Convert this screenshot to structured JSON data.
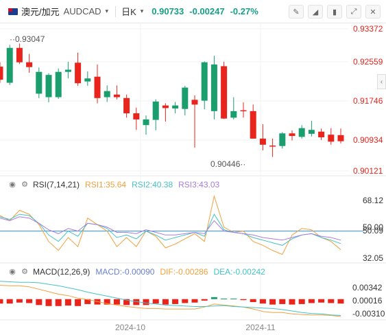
{
  "header": {
    "pair_name": "澳元/加元",
    "symbol": "AUDCAD",
    "caret": "▾",
    "period": "日K",
    "period_caret": "▾",
    "price": "0.90733",
    "change": "-0.00247",
    "change_pct": "-0.27%",
    "tools": [
      "pencil-ruler-icon",
      "brush-icon",
      "candlestick-icon",
      "expand-icon",
      "close-icon"
    ]
  },
  "colors": {
    "up": "#e8241c",
    "down": "#1a9e6e",
    "rsi1": "#f2a03c",
    "rsi2": "#45c2c7",
    "rsi3": "#a77be0",
    "dif": "#f2a03c",
    "dea": "#45c2c7",
    "ref": "#2f8bd6",
    "axis_text": "#e8241c"
  },
  "chart_data": [
    {
      "type": "candlestick",
      "x_ticks": [
        "2024-10",
        "2024-11"
      ],
      "y_ticks": [
        "0.93372",
        "0.92559",
        "0.91746",
        "0.90934",
        "0.90121"
      ],
      "ylim": [
        0.9005,
        0.9345
      ],
      "annotations": {
        "high": "0.93047",
        "low": "0.90446"
      },
      "ohlc": [
        [
          0.9252,
          0.9262,
          0.9215,
          0.9222
        ],
        [
          0.9215,
          0.9302,
          0.921,
          0.9295
        ],
        [
          0.9295,
          0.9305,
          0.9258,
          0.9262
        ],
        [
          0.9262,
          0.9281,
          0.9238,
          0.9251
        ],
        [
          0.919,
          0.925,
          0.918,
          0.924
        ],
        [
          0.9182,
          0.9237,
          0.917,
          0.9233
        ],
        [
          0.9182,
          0.9248,
          0.9178,
          0.924
        ],
        [
          0.924,
          0.9263,
          0.9225,
          0.9245
        ],
        [
          0.9261,
          0.9284,
          0.9208,
          0.9214
        ],
        [
          0.9218,
          0.9241,
          0.9208,
          0.9225
        ],
        [
          0.9229,
          0.9257,
          0.9168,
          0.918
        ],
        [
          0.9182,
          0.9209,
          0.9171,
          0.9196
        ],
        [
          0.9188,
          0.9209,
          0.9177,
          0.9182
        ],
        [
          0.918,
          0.9188,
          0.9135,
          0.9145
        ],
        [
          0.9145,
          0.9158,
          0.9107,
          0.9131
        ],
        [
          0.9118,
          0.914,
          0.9096,
          0.9131
        ],
        [
          0.913,
          0.9177,
          0.9106,
          0.9172
        ],
        [
          0.9163,
          0.9168,
          0.9126,
          0.9157
        ],
        [
          0.9156,
          0.9171,
          0.9145,
          0.9163
        ],
        [
          0.9155,
          0.9208,
          0.914,
          0.9204
        ],
        [
          0.9176,
          0.9186,
          0.9066,
          0.9165
        ],
        [
          0.9174,
          0.9264,
          0.9154,
          0.9262
        ],
        [
          0.915,
          0.9277,
          0.9131,
          0.9257
        ],
        [
          0.9253,
          0.9263,
          0.9132,
          0.9133
        ],
        [
          0.9135,
          0.9182,
          0.9131,
          0.915
        ],
        [
          0.9152,
          0.917,
          0.9135,
          0.915
        ],
        [
          0.915,
          0.9165,
          0.9087,
          0.9087
        ],
        [
          0.9087,
          0.912,
          0.906,
          0.9073
        ],
        [
          0.9071,
          0.9087,
          0.9045,
          0.907
        ],
        [
          0.907,
          0.9102,
          0.9064,
          0.9099
        ],
        [
          0.9099,
          0.9106,
          0.9083,
          0.9093
        ],
        [
          0.9091,
          0.9118,
          0.9087,
          0.9111
        ],
        [
          0.9098,
          0.9128,
          0.9092,
          0.9107
        ],
        [
          0.9103,
          0.911,
          0.9084,
          0.909
        ],
        [
          0.9096,
          0.9111,
          0.9073,
          0.908
        ],
        [
          0.9095,
          0.911,
          0.9076,
          0.9081
        ]
      ]
    },
    {
      "type": "line",
      "label": "RSI(7,14,21)",
      "y_ticks": [
        "68.12",
        "50.00",
        "50.09",
        "32.05"
      ],
      "ylim": [
        27,
        80
      ],
      "ref_level": 50,
      "series": [
        {
          "name": "RSI1",
          "value_label": "RSI1:35.64",
          "values": [
            62,
            58,
            66,
            63,
            55,
            42,
            35,
            45,
            38,
            60,
            55,
            50,
            38,
            45,
            38,
            50,
            46,
            37,
            40,
            44,
            48,
            42,
            77,
            53,
            49,
            50,
            42,
            39,
            35,
            32,
            47,
            52,
            51,
            45,
            42,
            35.64
          ]
        },
        {
          "name": "RSI2",
          "value_label": "RSI2:40.38",
          "values": [
            61,
            59,
            63,
            62,
            56,
            47,
            42,
            50,
            46,
            56,
            55,
            52,
            45,
            47,
            44,
            50,
            47,
            43,
            45,
            47,
            49,
            46,
            63,
            51,
            49,
            48,
            45,
            43,
            41,
            39,
            44,
            47,
            48,
            45,
            43,
            40.38
          ]
        },
        {
          "name": "RSI3",
          "value_label": "RSI3:43.03",
          "values": [
            60,
            58,
            61,
            60,
            56,
            51,
            48,
            52,
            50,
            56,
            55,
            53,
            49,
            49,
            48,
            51,
            49,
            47,
            47,
            48,
            49,
            48,
            58,
            50,
            49,
            48,
            47,
            45,
            44,
            43,
            45,
            47,
            48,
            46,
            45,
            43.03
          ]
        }
      ]
    },
    {
      "type": "bar+line",
      "label": "MACD(12,26,9)",
      "y_ticks": [
        "0.00342",
        "0.00016",
        "-0.00310"
      ],
      "ylim": [
        -0.0042,
        0.0044
      ],
      "series": [
        {
          "name": "MACD",
          "value_label": "MACD:-0.00090",
          "values": [
            -0.0009,
            -0.0009,
            -0.0007,
            -0.0008,
            -0.0012,
            -0.0014,
            -0.0014,
            -0.0013,
            -0.0014,
            -0.001,
            -0.0011,
            -0.0011,
            -0.0011,
            -0.0012,
            -0.0012,
            -0.0012,
            -0.0009,
            -0.0011,
            -0.001,
            -0.0008,
            -0.0007,
            -0.0003,
            0.0004,
            0.0001,
            0.0001,
            -0.0002,
            -0.0006,
            -0.0009,
            -0.0011,
            -0.001,
            -0.0011,
            -0.001,
            -0.0008,
            -0.0007,
            -0.0008,
            -0.0009
          ]
        },
        {
          "name": "DIF",
          "value_label": "DIF:-0.00286",
          "values": [
            0.0028,
            0.0027,
            0.0027,
            0.0025,
            0.002,
            0.0015,
            0.001,
            0.0007,
            0.0002,
            -0.0001,
            -0.0005,
            -0.0009,
            -0.0012,
            -0.0015,
            -0.0017,
            -0.0019,
            -0.0019,
            -0.002,
            -0.002,
            -0.002,
            -0.002,
            -0.0016,
            -0.001,
            -0.0012,
            -0.0014,
            -0.0016,
            -0.002,
            -0.0025,
            -0.0027,
            -0.0027,
            -0.003,
            -0.0031,
            -0.0032,
            -0.0032,
            -0.0033,
            -0.0035
          ]
        },
        {
          "name": "DEA",
          "value_label": "DEA:-0.00242",
          "values": [
            0.0036,
            0.0035,
            0.0034,
            0.0034,
            0.0033,
            0.003,
            0.0027,
            0.0023,
            0.0019,
            0.0014,
            0.001,
            0.0006,
            0.0002,
            -0.0002,
            -0.0005,
            -0.0008,
            -0.001,
            -0.0012,
            -0.0013,
            -0.0014,
            -0.0015,
            -0.0015,
            -0.0014,
            -0.0013,
            -0.0015,
            -0.0016,
            -0.0017,
            -0.0018,
            -0.0019,
            -0.0021,
            -0.0024,
            -0.0027,
            -0.0029,
            -0.003,
            -0.0032,
            -0.0033
          ]
        }
      ]
    }
  ]
}
